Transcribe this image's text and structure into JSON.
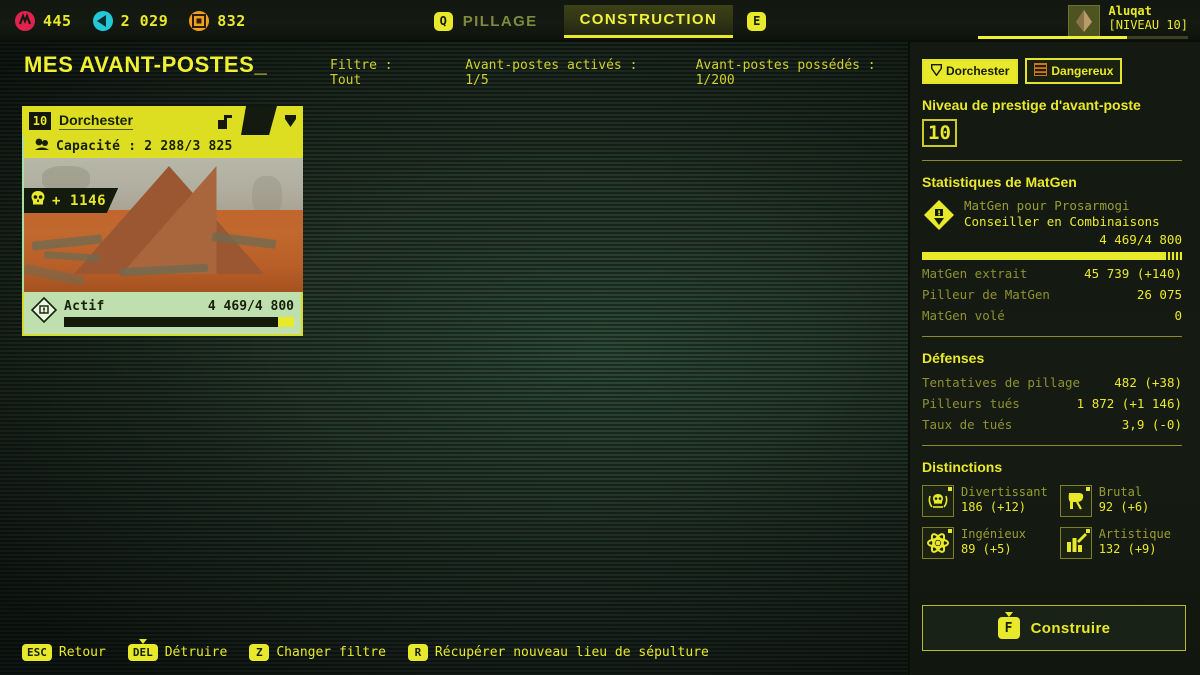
{
  "topbar": {
    "resources": [
      {
        "icon": "blood-icon",
        "color": "#e0234e",
        "value": "445"
      },
      {
        "icon": "shard-icon",
        "color": "#23c8d8",
        "value": "2 029"
      },
      {
        "icon": "gear-coin-icon",
        "color": "#f0a020",
        "value": "832"
      }
    ],
    "tabs": [
      {
        "key": "Q",
        "label": "PILLAGE",
        "active": false
      },
      {
        "key": "E",
        "label": "CONSTRUCTION",
        "active": true
      }
    ],
    "player": {
      "name": "Aluqat",
      "level": "[NIVEAU 10]",
      "xp_percent": 71
    }
  },
  "header": {
    "title": "MES AVANT-POSTES_",
    "filter": "Filtre : Tout",
    "activated": "Avant-postes activés : 1/5",
    "owned": "Avant-postes possédés : 1/200"
  },
  "card": {
    "level": "10",
    "name": "Dorchester",
    "capacity_label": "Capacité : 2 288/3 825",
    "kills_badge": "+ 1146",
    "state": "Actif",
    "progress_text": "4 469/4 800",
    "progress_percent": 93
  },
  "panel": {
    "chips": [
      {
        "icon": "shield-icon",
        "label": "Dorchester"
      },
      {
        "icon": "danger-icon",
        "label": "Dangereux"
      }
    ],
    "prestige_label": "Niveau de prestige d'avant-poste",
    "prestige_value": "10",
    "matgen": {
      "section_title": "Statistiques de MatGen",
      "subtitle": "MatGen pour Prosarmogi",
      "title": "Conseiller en Combinaisons",
      "value": "4 469/4 800",
      "percent": 93,
      "stats": [
        {
          "key": "MatGen extrait",
          "value": "45 739 (+140)"
        },
        {
          "key": "Pilleur de MatGen",
          "value": "26 075"
        },
        {
          "key": "MatGen volé",
          "value": "0"
        }
      ]
    },
    "defenses": {
      "section_title": "Défenses",
      "stats": [
        {
          "key": "Tentatives de pillage",
          "value": "482 (+38)"
        },
        {
          "key": "Pilleurs tués",
          "value": "1 872 (+1 146)"
        },
        {
          "key": "Taux de tués",
          "value": "3,9 (-0)"
        }
      ]
    },
    "distinctions": {
      "section_title": "Distinctions",
      "items": [
        {
          "icon": "skull-laurel-icon",
          "label": "Divertissant",
          "value": "186 (+12)"
        },
        {
          "icon": "axe-icon",
          "label": "Brutal",
          "value": "92 (+6)"
        },
        {
          "icon": "atom-icon",
          "label": "Ingénieux",
          "value": "89 (+5)"
        },
        {
          "icon": "chart-brush-icon",
          "label": "Artistique",
          "value": "132 (+9)"
        }
      ]
    },
    "build_button": {
      "key": "F",
      "label": "Construire"
    }
  },
  "footer": {
    "actions": [
      {
        "key": "ESC",
        "label": "Retour",
        "arrow": false
      },
      {
        "key": "DEL",
        "label": "Détruire",
        "arrow": true
      },
      {
        "key": "Z",
        "label": "Changer filtre",
        "arrow": false
      },
      {
        "key": "R",
        "label": "Récupérer nouveau lieu de sépulture",
        "arrow": false
      }
    ]
  },
  "theme": {
    "accent": "#e9e92b",
    "background": "#24352a",
    "panel_bg": "#141a12",
    "danger": "#f0a020"
  }
}
